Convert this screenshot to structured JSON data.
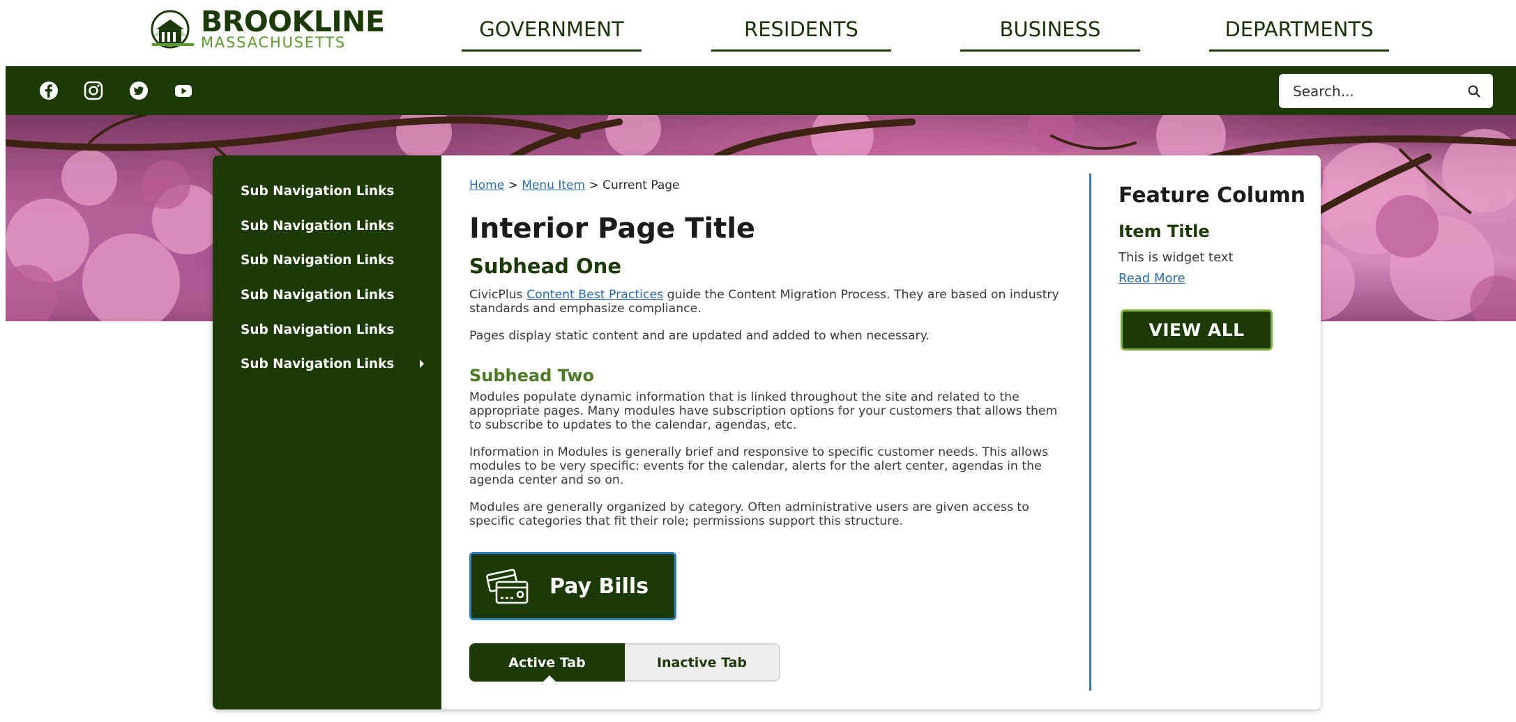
{
  "logo": {
    "name": "BROOKLINE",
    "sub": "MASSACHUSETTS"
  },
  "main_nav": [
    {
      "label": "GOVERNMENT"
    },
    {
      "label": "RESIDENTS"
    },
    {
      "label": "BUSINESS"
    },
    {
      "label": "DEPARTMENTS"
    }
  ],
  "social": [
    "facebook-icon",
    "instagram-icon",
    "twitter-icon",
    "youtube-icon"
  ],
  "search": {
    "placeholder": "Search..."
  },
  "subnav": [
    {
      "label": "Sub Navigation Links"
    },
    {
      "label": "Sub Navigation Links"
    },
    {
      "label": "Sub Navigation Links"
    },
    {
      "label": "Sub Navigation Links"
    },
    {
      "label": "Sub Navigation Links"
    },
    {
      "label": "Sub Navigation Links",
      "has_children": true
    }
  ],
  "breadcrumb": {
    "home": "Home",
    "sep1": " > ",
    "menu_item": "Menu Item",
    "sep2": " > ",
    "current": "Current Page"
  },
  "content": {
    "title": "Interior Page Title",
    "subhead_one": "Subhead One",
    "p1_prefix": "CivicPlus ",
    "p1_link": "Content Best Practices",
    "p1_suffix": " guide the Content Migration Process. They are based on industry standards and emphasize compliance.",
    "p2": "Pages display static content and are updated and added to when necessary.",
    "subhead_two": "Subhead Two",
    "p3": "Modules populate dynamic information that is linked throughout the site and related to the appropriate pages. Many modules have subscription options for your customers that allows them to subscribe to updates to the calendar, agendas, etc.",
    "p4": "Information in Modules is generally brief and responsive to specific customer needs. This allows modules to be very specific: events for the calendar, alerts for the alert center, agendas in the agenda center and so on.",
    "p5": "Modules are generally organized by category. Often administrative users are given access to specific categories that fit their role; permissions support this structure.",
    "pay_bills": "Pay Bills",
    "tabs": {
      "active": "Active Tab",
      "inactive": "Inactive Tab"
    }
  },
  "feature": {
    "title": "Feature Column",
    "item_title": "Item Title",
    "widget_text": "This is widget text",
    "read_more": "Read More",
    "view_all": "VIEW ALL"
  },
  "colors": {
    "brand_green": "#1c3a04",
    "accent_green": "#7fb23a",
    "link_blue": "#2a6db0"
  }
}
